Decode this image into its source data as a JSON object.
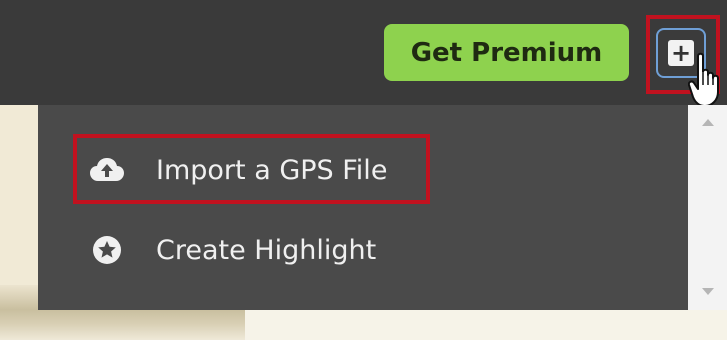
{
  "header": {
    "premium_label": "Get Premium",
    "add_label": "+"
  },
  "menu": {
    "items": [
      {
        "label": "Import a GPS File",
        "icon": "cloud-upload-icon"
      },
      {
        "label": "Create Highlight",
        "icon": "star-circle-icon"
      }
    ]
  },
  "colors": {
    "topbar": "#3a3a3a",
    "premium": "#8ed24e",
    "menu_bg": "#4a4a4a",
    "highlight_box": "#c1121f"
  }
}
